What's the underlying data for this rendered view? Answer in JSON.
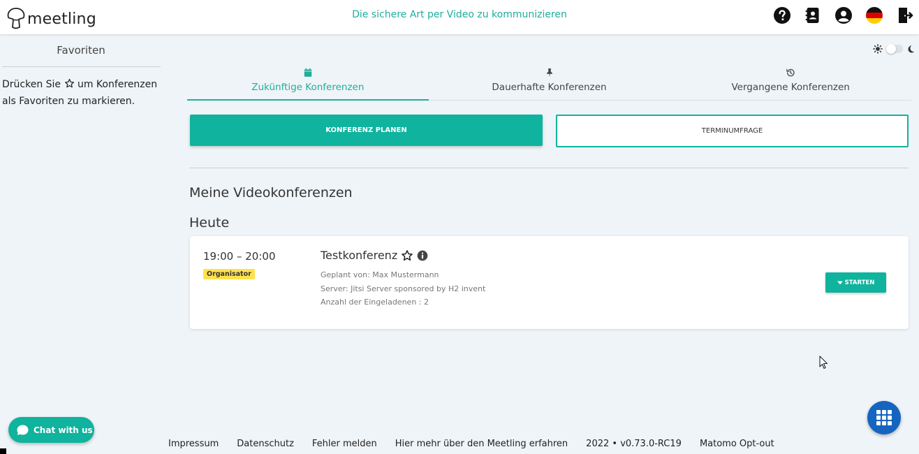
{
  "header": {
    "logo_text": "meetling",
    "tagline": "Die sichere Art per Video zu kommunizieren",
    "icons": [
      "help-icon",
      "contacts-icon",
      "account-icon",
      "german-flag-icon",
      "logout-icon"
    ]
  },
  "sidebar": {
    "title": "Favoriten",
    "hint_before": "Drücken Sie ",
    "hint_after": " um Konferenzen als Favoriten zu markieren."
  },
  "theme_toggle": {
    "icons": [
      "sun-icon",
      "moon-icon"
    ],
    "mode": "light"
  },
  "tabs": [
    {
      "label": "Zukünftige Konferenzen",
      "icon": "calendar-icon",
      "active": true
    },
    {
      "label": "Dauerhafte Konferenzen",
      "icon": "pin-icon",
      "active": false
    },
    {
      "label": "Vergangene Konferenzen",
      "icon": "history-icon",
      "active": false
    }
  ],
  "actions": {
    "plan_label": "KONFERENZ PLANEN",
    "poll_label": "TERMINUMFRAGE"
  },
  "main": {
    "section_title": "Meine Videokonferenzen",
    "day_title": "Heute"
  },
  "conference": {
    "time": "19:00 – 20:00",
    "role": "Organisator",
    "name": "Testkonferenz",
    "planned_by": "Geplant von: Max Mustermann",
    "server": "Server: Jitsi Server sponsored by H2 invent",
    "invited": "Anzahl der Eingeladenen : 2",
    "start_label": "STARTEN"
  },
  "chat": {
    "label": "Chat with us"
  },
  "footer": {
    "links": [
      "Impressum",
      "Datenschutz",
      "Fehler melden",
      "Hier mehr über den Meetling erfahren",
      "2022 • v0.73.0-RC19",
      "Matomo Opt-out"
    ]
  },
  "colors": {
    "accent": "#10b39d",
    "tagline": "#1fae9a",
    "badge": "#ffe14d",
    "fab": "#1565c0",
    "background": "#eff4f8"
  }
}
